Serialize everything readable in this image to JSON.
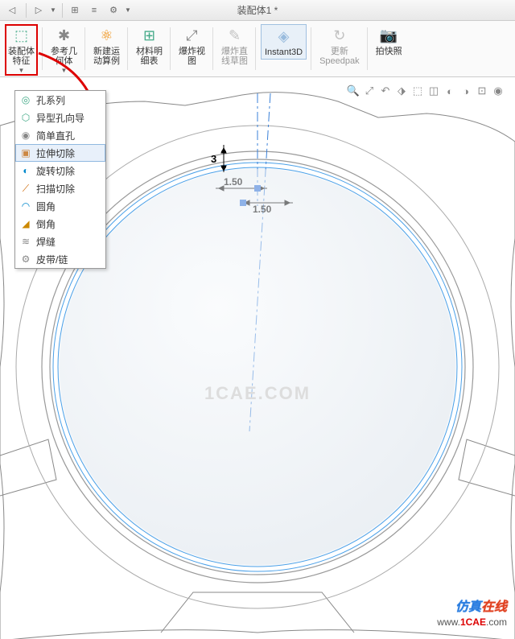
{
  "window": {
    "title": "装配体1 *"
  },
  "ribbon": {
    "assembly_feature": "装配体\n特征",
    "ref_geometry": "参考几\n何体",
    "new_motion": "新建运\n动算例",
    "bom": "材料明\n细表",
    "exploded_view": "爆炸视\n图",
    "exploded_line": "爆炸直\n线草图",
    "instant3d": "Instant3D",
    "update_speedpak": "更新\nSpeedpak",
    "take_photo": "拍快照"
  },
  "dropdown": {
    "items": [
      {
        "label": "孔系列",
        "icon": "◎"
      },
      {
        "label": "异型孔向导",
        "icon": "⬡"
      },
      {
        "label": "简单直孔",
        "icon": "◉"
      },
      {
        "label": "拉伸切除",
        "icon": "▣",
        "selected": true
      },
      {
        "label": "旋转切除",
        "icon": "◐"
      },
      {
        "label": "扫描切除",
        "icon": "⟋"
      },
      {
        "label": "圆角",
        "icon": "◠"
      },
      {
        "label": "倒角",
        "icon": "◢"
      },
      {
        "label": "焊缝",
        "icon": "≋"
      },
      {
        "label": "皮带/链",
        "icon": "⚙"
      }
    ]
  },
  "dimensions": {
    "d1": "3",
    "d2": "1.50",
    "d3": "1.50"
  },
  "watermark": {
    "center": "1CAE.COM",
    "brand_cn1": "仿真",
    "brand_cn2": "在线",
    "url_w": "www.",
    "url_d": "1CAE",
    "url_t": ".com"
  }
}
